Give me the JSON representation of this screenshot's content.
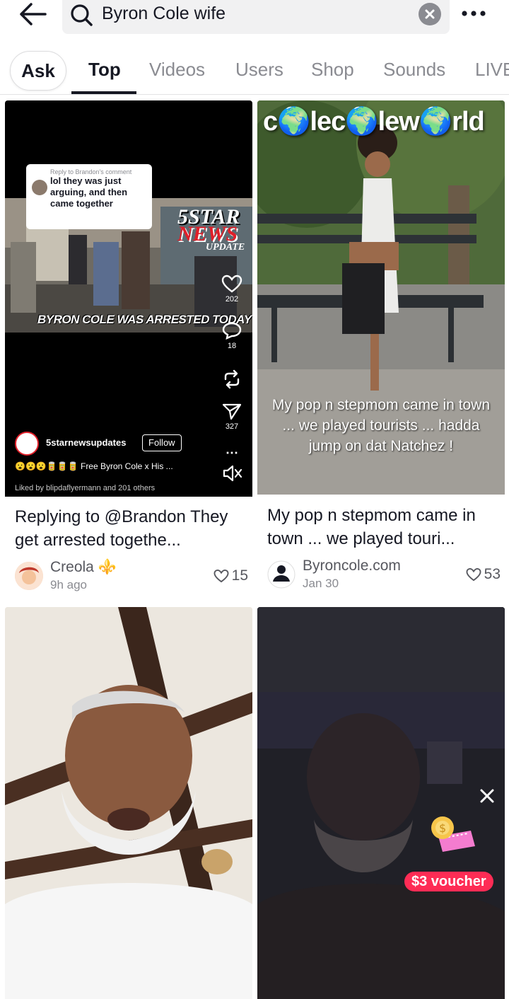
{
  "search": {
    "query": "Byron Cole wife"
  },
  "tabs": [
    {
      "label": "Ask"
    },
    {
      "label": "Top"
    },
    {
      "label": "Videos"
    },
    {
      "label": "Users"
    },
    {
      "label": "Shop"
    },
    {
      "label": "Sounds"
    },
    {
      "label": "LIVE"
    }
  ],
  "colors": {
    "accent": "#fe2c55",
    "text": "#161823",
    "muted": "#8a8b91"
  },
  "results": [
    {
      "overlay": {
        "reply_caption": "Reply to Brandon's comment",
        "reply_text": "lol they was just arguing, and then came together",
        "logo_line1": "5STAR",
        "logo_line2": "NEWS",
        "logo_line3": "UPDATE",
        "headline": "BYRON COLE WAS ARRESTED TODAY",
        "likes": "202",
        "comments": "18",
        "shares": "327",
        "username": "5starnewsupdates",
        "follow": "Follow",
        "description": "😮😮😮🥫🥫🥫 Free Byron Cole x His ...",
        "liked_by": "Liked by blipdaflyermann and 201 others"
      },
      "description": "Replying to @Brandon They get arrested togethe...",
      "author": "Creola ⚜️",
      "time": "9h ago",
      "likes": "15"
    },
    {
      "overlay": {
        "title": "c🌍lec🌍lew🌍rld",
        "caption": "My pop n stepmom came in town ... we played tourists ... hadda jump on dat Natchez !"
      },
      "description": "My pop n stepmom came in town ... we played touri...",
      "author": "Byroncole.com",
      "time": "Jan 30",
      "likes": "53"
    },
    {
      "description": ""
    },
    {
      "description": ""
    }
  ],
  "voucher": {
    "label": "$3 voucher"
  }
}
